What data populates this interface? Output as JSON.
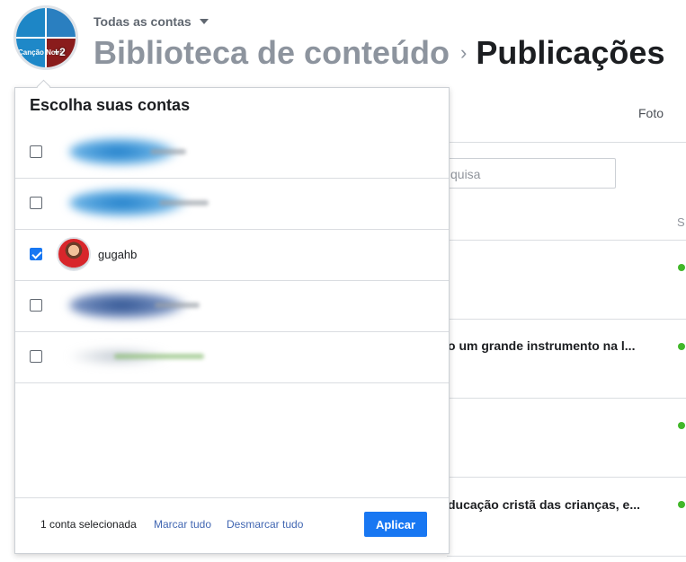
{
  "header": {
    "account_switcher_label": "Todas as contas",
    "avatar_more_count": "+2",
    "avatar_brand_text": "Canção Nova",
    "breadcrumb_parent": "Biblioteca de conteúdo",
    "breadcrumb_separator": "›",
    "breadcrumb_current": "Publicações"
  },
  "background": {
    "tab_label": "Foto",
    "search_placeholder_fragment": "quisa",
    "column_header_fragment": "S",
    "rows": [
      {
        "title": ""
      },
      {
        "title": "o um grande instrumento na l..."
      },
      {
        "title": ""
      },
      {
        "title": "ducação cristã das crianças, e..."
      }
    ],
    "status_color": "#42b72a"
  },
  "account_picker": {
    "title": "Escolha suas contas",
    "accounts": [
      {
        "name": "",
        "checked": false,
        "blurred": true
      },
      {
        "name": "",
        "checked": false,
        "blurred": true
      },
      {
        "name": "gugahb",
        "checked": true,
        "blurred": false
      },
      {
        "name": "",
        "checked": false,
        "blurred": true
      },
      {
        "name": "",
        "checked": false,
        "blurred": true
      }
    ],
    "footer": {
      "selected_count": "1 conta selecionada",
      "select_all": "Marcar tudo",
      "deselect_all": "Desmarcar tudo",
      "apply": "Aplicar"
    },
    "accent_color": "#1877f2"
  }
}
